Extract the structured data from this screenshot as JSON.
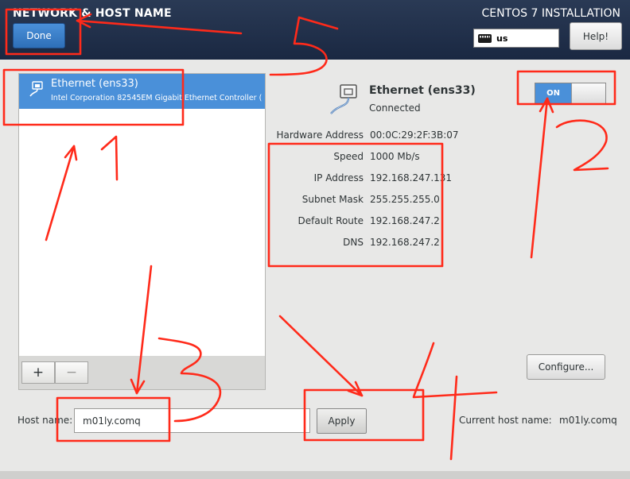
{
  "header": {
    "spoke_title": "NETWORK & HOST NAME",
    "install_title": "CENTOS 7 INSTALLATION",
    "done_label": "Done",
    "keyboard_layout": "us",
    "help_label": "Help!"
  },
  "device_list": {
    "items": [
      {
        "name": "Ethernet (ens33)",
        "description": "Intel Corporation 82545EM Gigabit Ethernet Controller ("
      }
    ],
    "add_label": "+",
    "remove_label": "−"
  },
  "device_detail": {
    "name": "Ethernet (ens33)",
    "status": "Connected",
    "toggle_label": "ON",
    "toggle_state": "on",
    "properties": {
      "hardware_address": {
        "label": "Hardware Address",
        "value": "00:0C:29:2F:3B:07"
      },
      "speed": {
        "label": "Speed",
        "value": "1000 Mb/s"
      },
      "ip_address": {
        "label": "IP Address",
        "value": "192.168.247.131"
      },
      "subnet_mask": {
        "label": "Subnet Mask",
        "value": "255.255.255.0"
      },
      "default_route": {
        "label": "Default Route",
        "value": "192.168.247.2"
      },
      "dns": {
        "label": "DNS",
        "value": "192.168.247.2"
      }
    },
    "configure_label": "Configure..."
  },
  "hostname": {
    "label": "Host name:",
    "value": "m01ly.comq",
    "apply_label": "Apply",
    "current_label": "Current host name:",
    "current_value": "m01ly.comq"
  },
  "annotations": {
    "color": "#ff2a1a",
    "numbers": [
      "1",
      "2",
      "3",
      "4",
      "5"
    ]
  },
  "colors": {
    "header_bg": "#1f2e4a",
    "accent": "#4a90d9",
    "panel_bg": "#e8e8e7"
  }
}
